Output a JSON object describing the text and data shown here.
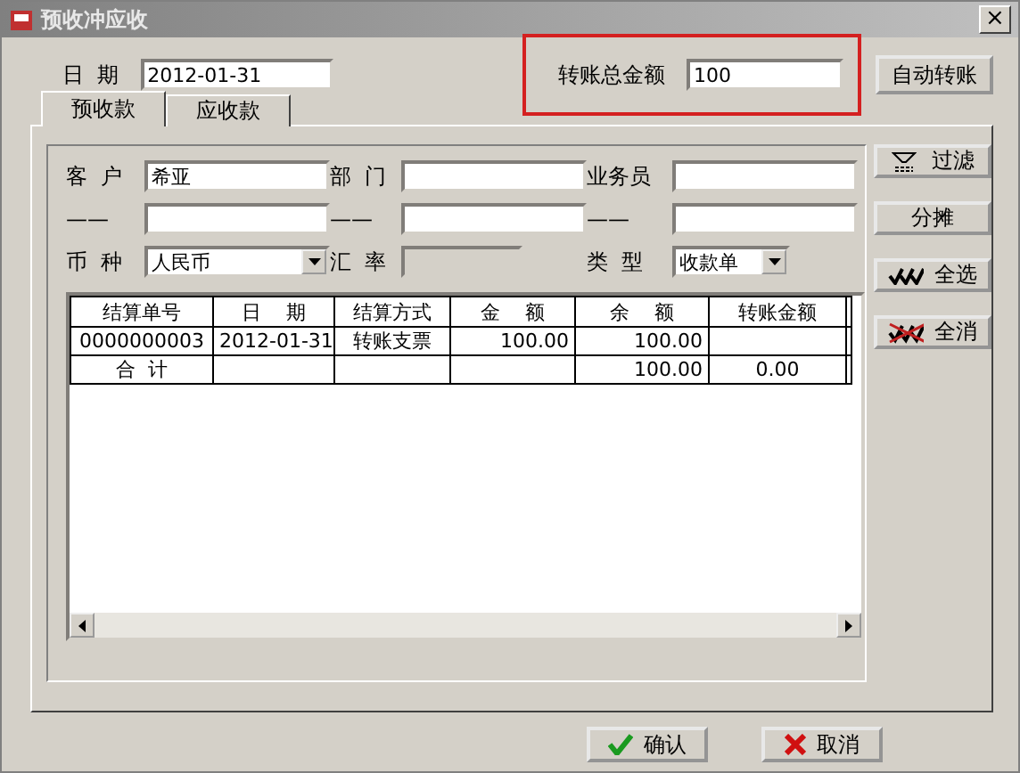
{
  "window": {
    "title": "预收冲应收",
    "close": "×"
  },
  "date": {
    "label": "日  期",
    "value": "2012-01-31"
  },
  "transfer_total": {
    "label": "转账总金额",
    "value": "100",
    "highlighted": true
  },
  "auto_button": "自动转账",
  "tabs": [
    {
      "label": "预收款",
      "selected": true
    },
    {
      "label": "应收款",
      "selected": false
    }
  ],
  "fields": [
    {
      "kind": "input",
      "label": "客  户",
      "value": "希亚"
    },
    {
      "kind": "input",
      "label": "部  门"
    },
    {
      "kind": "input",
      "label": "业务员"
    },
    {
      "kind": "input",
      "label": "——"
    },
    {
      "kind": "input",
      "label": "——"
    },
    {
      "kind": "input",
      "label": "——"
    },
    {
      "kind": "select",
      "label": "币  种",
      "value": "人民币"
    },
    {
      "kind": "disabled",
      "label": "汇  率"
    },
    {
      "kind": "select",
      "label": "类  型",
      "value": "收款单"
    }
  ],
  "table": {
    "columns": [
      "结算单号",
      "日    期",
      "结算方式",
      "金    额",
      "余    额",
      "转账金额"
    ],
    "rows": [
      {
        "kind": "data",
        "cells": [
          "0000000003",
          "2012-01-31",
          "转账支票",
          "100.00",
          "100.00",
          ""
        ]
      },
      {
        "kind": "total",
        "cells": [
          "合  计",
          "",
          "",
          "",
          "100.00",
          "0.00"
        ]
      }
    ]
  },
  "side_buttons": [
    {
      "kind": "filter",
      "label": "过滤"
    },
    {
      "kind": "plain",
      "label": "分摊"
    },
    {
      "kind": "select_all",
      "label": "全选"
    },
    {
      "kind": "clear_all",
      "label": "全消"
    }
  ],
  "footer_buttons": [
    {
      "kind": "ok",
      "label": "确认"
    },
    {
      "kind": "cancel",
      "label": "取消"
    }
  ]
}
